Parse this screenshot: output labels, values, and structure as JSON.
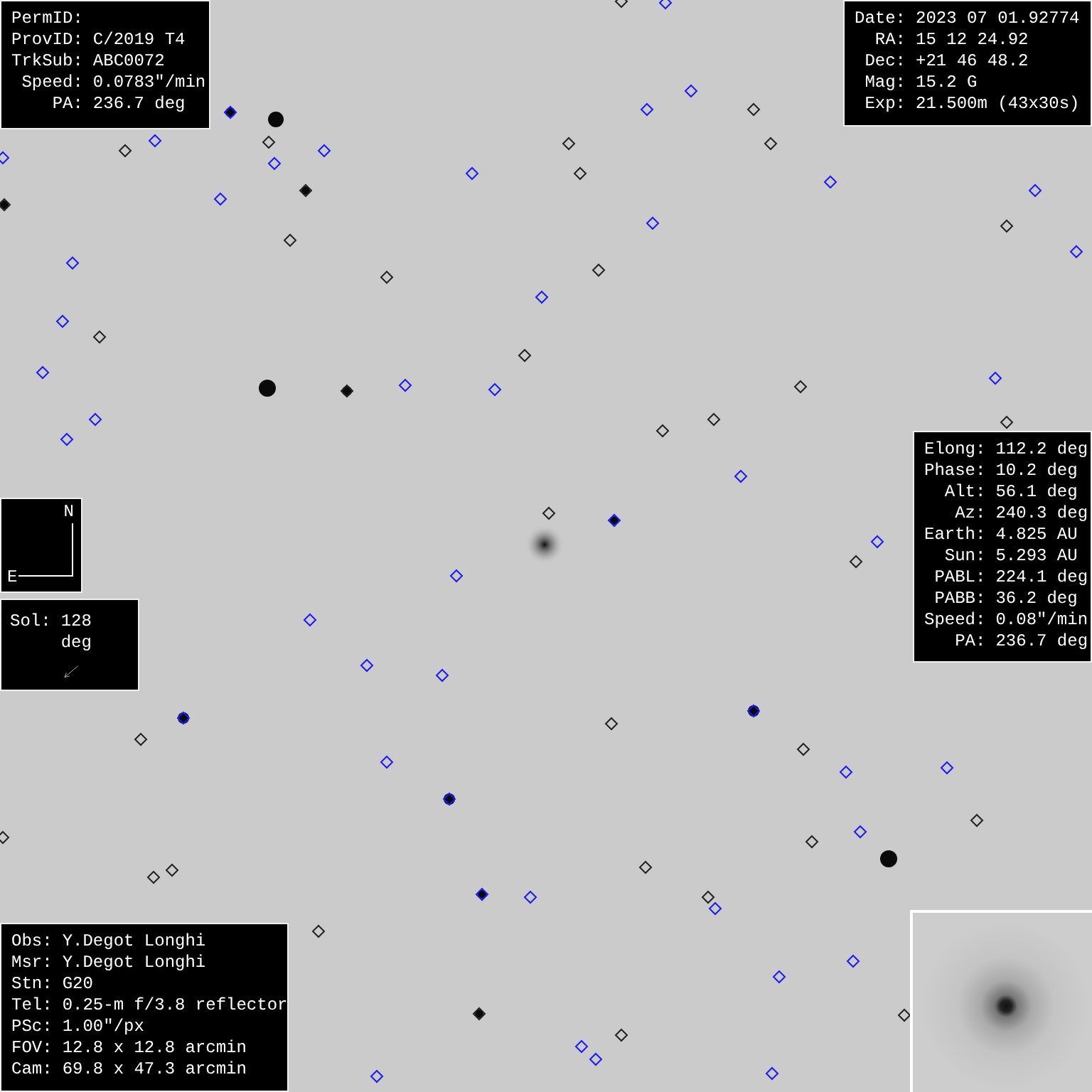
{
  "object_info": {
    "lines": [
      {
        "label": "PermID:"
      },
      {
        "label": "ProvID:",
        "value": "C/2019 T4"
      },
      {
        "label": "TrkSub:",
        "value": "ABC0072"
      },
      {
        "label": "Speed:",
        "value": "0.0783\"/min"
      },
      {
        "label": "PA:",
        "value": "236.7 deg"
      }
    ]
  },
  "observation_info": {
    "lines": [
      {
        "label": "Date:",
        "value": "2023 07 01.92774"
      },
      {
        "label": "RA:",
        "value": "15 12 24.92"
      },
      {
        "label": "Dec:",
        "value": "+21 46 48.2"
      },
      {
        "label": "Mag:",
        "value": "15.2 G"
      },
      {
        "label": "Exp:",
        "value": "21.500m (43x30s)"
      }
    ]
  },
  "geometry_info": {
    "lines": [
      {
        "label": "Elong:",
        "value": "112.2 deg"
      },
      {
        "label": "Phase:",
        "value": "10.2 deg"
      },
      {
        "label": "Alt:",
        "value": "56.1 deg"
      },
      {
        "label": "Az:",
        "value": "240.3 deg"
      },
      {
        "label": "Earth:",
        "value": "4.825 AU"
      },
      {
        "label": "Sun:",
        "value": "5.293 AU"
      },
      {
        "label": "PABL:",
        "value": "224.1 deg"
      },
      {
        "label": "PABB:",
        "value": "36.2 deg"
      },
      {
        "label": "Speed:",
        "value": "0.08\"/min"
      },
      {
        "label": "PA:",
        "value": "236.7 deg"
      }
    ]
  },
  "compass": {
    "north": "N",
    "east": "E"
  },
  "sun_direction": {
    "label": "Sol:",
    "value": "128 deg"
  },
  "site_info": {
    "lines": [
      {
        "label": "Obs:",
        "value": "Y.Degot Longhi"
      },
      {
        "label": "Msr:",
        "value": "Y.Degot Longhi"
      },
      {
        "label": "Stn:",
        "value": "G20"
      },
      {
        "label": "Tel:",
        "value": "0.25-m f/3.8 reflector"
      },
      {
        "label": "PSc:",
        "value": "1.00\"/px"
      },
      {
        "label": "FOV:",
        "value": "12.8 x 12.8 arcmin"
      },
      {
        "label": "Cam:",
        "value": "69.8 x 47.3 arcmin"
      }
    ]
  }
}
